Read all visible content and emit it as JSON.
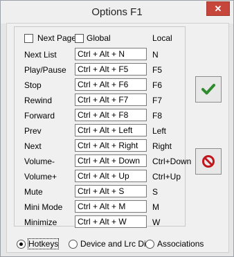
{
  "window": {
    "title": "Options F1"
  },
  "panel": {
    "next_page_label": "Next Page",
    "global_label": "Global",
    "local_header": "Local",
    "rows": [
      {
        "label": "Next List",
        "hotkey": "Ctrl + Alt + N",
        "local": "N"
      },
      {
        "label": "Play/Pause",
        "hotkey": "Ctrl + Alt + F5",
        "local": "F5"
      },
      {
        "label": "Stop",
        "hotkey": "Ctrl + Alt + F6",
        "local": "F6"
      },
      {
        "label": "Rewind",
        "hotkey": "Ctrl + Alt + F7",
        "local": "F7"
      },
      {
        "label": "Forward",
        "hotkey": "Ctrl + Alt + F8",
        "local": "F8"
      },
      {
        "label": "Prev",
        "hotkey": "Ctrl + Alt + Left",
        "local": "Left"
      },
      {
        "label": "Next",
        "hotkey": "Ctrl + Alt + Right",
        "local": "Right"
      },
      {
        "label": "Volume-",
        "hotkey": "Ctrl + Alt + Down",
        "local": "Ctrl+Down"
      },
      {
        "label": "Volume+",
        "hotkey": "Ctrl + Alt + Up",
        "local": "Ctrl+Up"
      },
      {
        "label": "Mute",
        "hotkey": "Ctrl + Alt + S",
        "local": "S"
      },
      {
        "label": "Mini Mode",
        "hotkey": "Ctrl + Alt + M",
        "local": "M"
      },
      {
        "label": "Minimize",
        "hotkey": "Ctrl + Alt + W",
        "local": "W"
      }
    ]
  },
  "tabs": {
    "hotkeys": "Hotkeys",
    "device": "Device and Lrc Dir",
    "associations": "Associations"
  },
  "icons": {
    "close": "close-icon",
    "ok": "checkmark-icon",
    "cancel": "no-sign-icon"
  },
  "colors": {
    "ok_green": "#2e8b2e",
    "cancel_red": "#c0161d",
    "close_red": "#c7463c"
  }
}
